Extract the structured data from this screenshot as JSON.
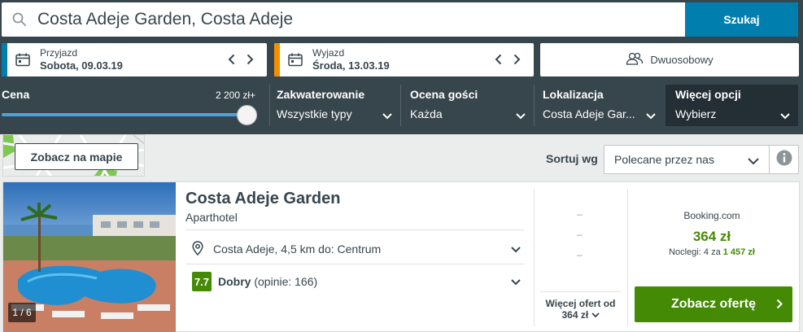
{
  "search": {
    "value": "Costa Adeje Garden, Costa Adeje",
    "button": "Szukaj",
    "icon": "search-icon"
  },
  "checkin": {
    "label": "Przyjazd",
    "value": "Sobota, 09.03.19",
    "accent": "#007faf"
  },
  "checkout": {
    "label": "Wyjazd",
    "value": "Środa, 13.03.19",
    "accent": "#f48f00"
  },
  "room": {
    "label": "Dwuosobowy",
    "icon": "people-icon"
  },
  "filters": {
    "price": {
      "title": "Cena",
      "max": "2 200 zł+",
      "level_percent": 100
    },
    "accommodation": {
      "title": "Zakwaterowanie",
      "value": "Wszystkie typy"
    },
    "rating": {
      "title": "Ocena gości",
      "value": "Każda"
    },
    "location": {
      "title": "Lokalizacja",
      "value": "Costa Adeje Gar..."
    },
    "more": {
      "title": "Więcej opcji",
      "value": "Wybierz"
    }
  },
  "map": {
    "button": "Zobacz na mapie"
  },
  "sort": {
    "label": "Sortuj wg",
    "value": "Polecane przez nas"
  },
  "hotel": {
    "photo_counter": "1 / 6",
    "name": "Costa Adeje Garden",
    "type": "Aparthotel",
    "location": "Costa Adeje, 4,5 km do: Centrum",
    "rating_score": "7.7",
    "rating_label": "Dobry",
    "rating_reviews": "(opinie: 166)",
    "offers_dashes": [
      "–",
      "–",
      "–"
    ],
    "more_offers_line1": "Więcej ofert od",
    "more_offers_line2": "364 zł",
    "provider": "Booking.com",
    "price": "364 zł",
    "nights_prefix": "Noclegi: 4 za",
    "nights_total": "1 457 zł",
    "cta": "Zobacz ofertę"
  },
  "colors": {
    "header_bg": "#37454d",
    "search_btn": "#007faf",
    "green": "#458a05",
    "more_filter_bg": "#232f35"
  }
}
